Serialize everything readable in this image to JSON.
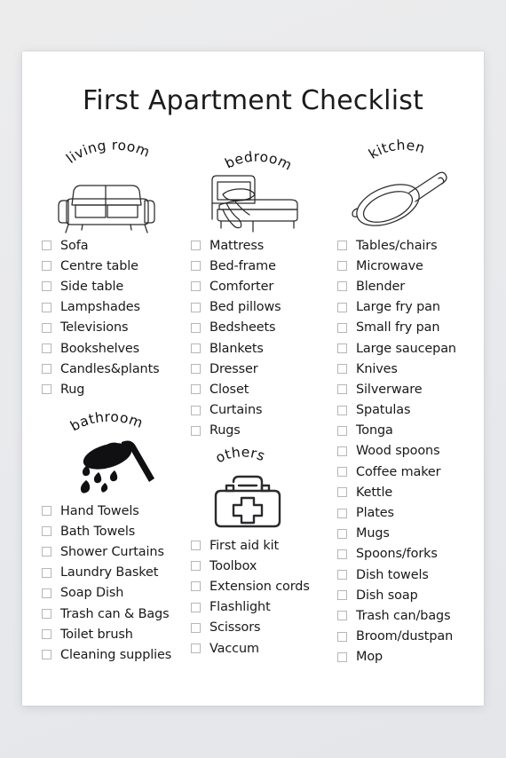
{
  "page": {
    "title": "First Apartment Checklist",
    "background_color": "#e9eaec",
    "paper_color": "#ffffff",
    "text_color": "#18191b",
    "checkbox_border_color": "#b6b7ba"
  },
  "sections": {
    "living_room": {
      "label": "living room",
      "icon": "sofa-illustration",
      "items": [
        "Sofa",
        "Centre table",
        "Side table",
        "Lampshades",
        "Televisions",
        "Bookshelves",
        "Candles&plants",
        "Rug"
      ]
    },
    "bedroom": {
      "label": "bedroom",
      "icon": "bed-illustration",
      "items": [
        "Mattress",
        "Bed-frame",
        "Comforter",
        "Bed pillows",
        "Bedsheets",
        "Blankets",
        "Dresser",
        "Closet",
        "Curtains",
        "Rugs"
      ]
    },
    "kitchen": {
      "label": "kitchen",
      "icon": "frying-pan-illustration",
      "items": [
        "Tables/chairs",
        "Microwave",
        "Blender",
        "Large fry pan",
        "Small fry pan",
        "Large saucepan",
        "Knives",
        "Silverware",
        "Spatulas",
        "Tonga",
        "Wood spoons",
        "Coffee maker",
        "Kettle",
        "Plates",
        "Mugs",
        "Spoons/forks",
        "Dish towels",
        "Dish soap",
        "Trash can/bags",
        "Broom/dustpan",
        "Mop"
      ]
    },
    "bathroom": {
      "label": "bathroom",
      "icon": "shower-head-illustration",
      "items": [
        "Hand Towels",
        "Bath Towels",
        "Shower Curtains",
        "Laundry Basket",
        "Soap Dish",
        "Trash can & Bags",
        "Toilet brush",
        "Cleaning supplies"
      ]
    },
    "others": {
      "label": "others",
      "icon": "first-aid-kit-illustration",
      "items": [
        "First aid kit",
        "Toolbox",
        "Extension cords",
        "Flashlight",
        "Scissors",
        "Vaccum"
      ]
    }
  }
}
